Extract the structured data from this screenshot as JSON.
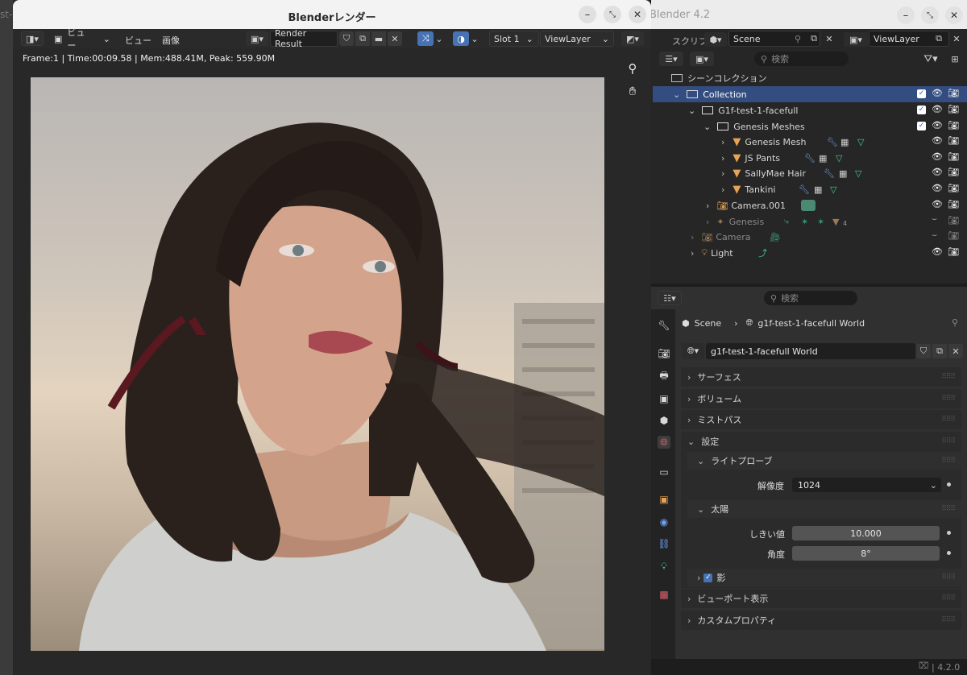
{
  "main_window": {
    "title": "Blender 4.2",
    "left_edge_text": "st-",
    "header": {
      "script_tab": "スクリプ",
      "scene_name": "Scene",
      "view_layer": "ViewLayer"
    },
    "outliner": {
      "search_placeholder": "検索",
      "root": "シーンコレクション",
      "items": [
        {
          "label": "Collection"
        },
        {
          "label": "G1f-test-1-facefull"
        },
        {
          "label": "Genesis Meshes"
        },
        {
          "label": "Genesis Mesh"
        },
        {
          "label": "JS Pants"
        },
        {
          "label": "SallyMae Hair"
        },
        {
          "label": "Tankini"
        },
        {
          "label": "Camera.001"
        },
        {
          "label": "Genesis",
          "badge": "4"
        },
        {
          "label": "Camera"
        },
        {
          "label": "Light"
        }
      ]
    },
    "properties": {
      "search_placeholder": "検索",
      "breadcrumb_scene": "Scene",
      "breadcrumb_world": "g1f-test-1-facefull World",
      "world_name": "g1f-test-1-facefull World",
      "panels": {
        "surface": "サーフェス",
        "volume": "ボリューム",
        "mist": "ミストパス",
        "settings": "設定",
        "light_probe": "ライトプローブ",
        "resolution_label": "解像度",
        "resolution_value": "1024",
        "sun": "太陽",
        "threshold_label": "しきい値",
        "threshold_value": "10.000",
        "angle_label": "角度",
        "angle_value": "8°",
        "shadow": "影",
        "viewport_display": "ビューポート表示",
        "custom_props": "カスタムプロパティ"
      }
    },
    "status_version": "4.2.0"
  },
  "render_window": {
    "title": "Blenderレンダー",
    "menu": {
      "view1": "ビュー",
      "view2": "ビュー",
      "image": "画像"
    },
    "image_name": "Render Result",
    "slot": "Slot 1",
    "view_layer": "ViewLayer",
    "stats": "Frame:1 | Time:00:09.58 | Mem:488.41M, Peak: 559.90M"
  },
  "colors": {
    "selection": "#334d80",
    "accent_blue": "#4772b3",
    "object_orange": "#e8a455"
  }
}
